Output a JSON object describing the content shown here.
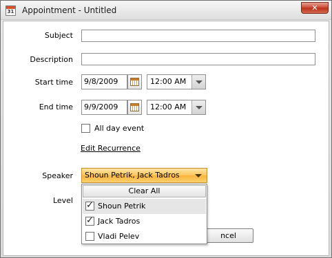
{
  "window": {
    "title": "Appointment - Untitled",
    "icon_text": "31",
    "close_glyph": "✕"
  },
  "form": {
    "subject_label": "Subject",
    "subject_value": "",
    "description_label": "Description",
    "description_value": "",
    "start_label": "Start time",
    "start_date": "9/8/2009",
    "start_time": "12:00 AM",
    "end_label": "End time",
    "end_date": "9/9/2009",
    "end_time": "12:00 AM",
    "all_day_label": "All day event",
    "all_day_checked": false,
    "edit_recurrence": "Edit Recurrence",
    "speaker_label": "Speaker",
    "speaker_value": "Shoun Petrik, Jack Tadros",
    "level_label": "Level"
  },
  "speaker_dropdown": {
    "clear_all": "Clear All",
    "items": [
      {
        "label": "Shoun Petrik",
        "checked": true
      },
      {
        "label": "Jack Tadros",
        "checked": true
      },
      {
        "label": "Vladi Pelev",
        "checked": false
      }
    ]
  },
  "buttons": {
    "cancel_visible": "ncel"
  }
}
